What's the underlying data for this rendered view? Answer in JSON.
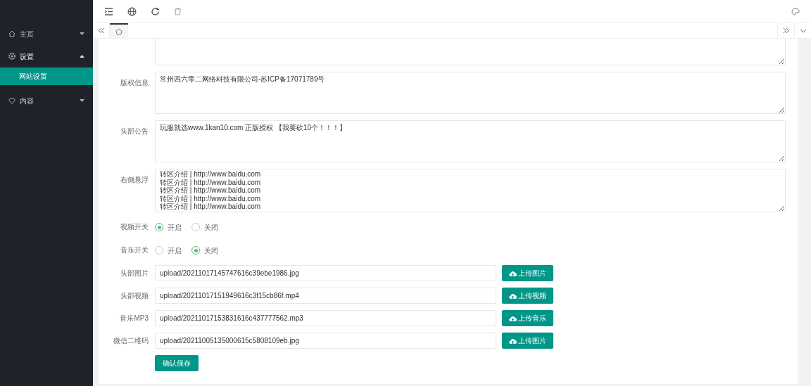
{
  "sidebar": {
    "items": [
      {
        "label": "主页",
        "expanded": false,
        "selected": false
      },
      {
        "label": "设置",
        "expanded": true,
        "selected": false,
        "children": [
          {
            "label": "网站设置",
            "selected": true
          }
        ]
      },
      {
        "label": "内容",
        "expanded": false,
        "selected": false
      }
    ]
  },
  "tabs": [
    {
      "kind": "home",
      "selected": true
    }
  ],
  "form": {
    "fields": [
      {
        "kind": "textarea"
      },
      {
        "kind": "textarea",
        "label": "版权信息",
        "value": "常州四六零二网络科技有限公司-苏ICP备17071789号"
      },
      {
        "kind": "textarea",
        "label": "头部公告",
        "value": "玩服就选www.1kan10.com 正版授权 【我要砍10个！！！】"
      },
      {
        "kind": "textarea",
        "label": "右侧悬浮",
        "value": "转区介绍 | http://www.baidu.com\n转区介绍 | http://www.baidu.com\n转区介绍 | http://www.baidu.com\n转区介绍 | http://www.baidu.com\n转区介绍 | http://www.baidu.com"
      },
      {
        "kind": "radio",
        "label": "视频开关",
        "options": [
          {
            "label": "开启",
            "selected": true
          },
          {
            "label": "关闭",
            "selected": false
          }
        ]
      },
      {
        "kind": "radio",
        "label": "音乐开关",
        "options": [
          {
            "label": "开启",
            "selected": false
          },
          {
            "label": "关闭",
            "selected": true
          }
        ]
      },
      {
        "kind": "upload",
        "label": "头部图片",
        "value": "upload/20211017145747616c39ebe1986.jpg",
        "button": "上传图片"
      },
      {
        "kind": "upload",
        "label": "头部视频",
        "value": "upload/20211017151949616c3f15cb86f.mp4",
        "button": "上传视频"
      },
      {
        "kind": "upload",
        "label": "音乐MP3",
        "value": "upload/20211017153831616c437777562.mp3",
        "button": "上传音乐"
      },
      {
        "kind": "upload",
        "label": "微信二维码",
        "value": "upload/20211005135000615c5808109eb.jpg",
        "button": "上传图片"
      }
    ],
    "submit": "确认保存"
  }
}
